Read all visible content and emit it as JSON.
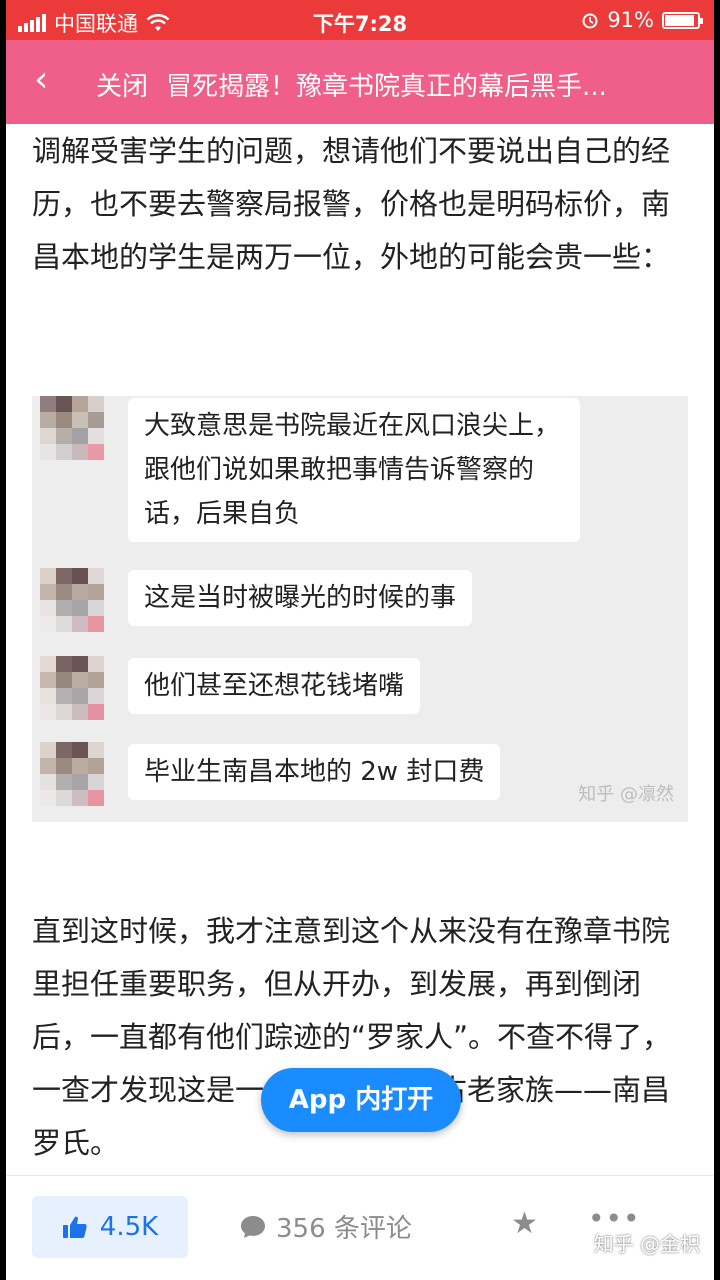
{
  "status_bar": {
    "carrier": "中国联通",
    "time": "下午7:28",
    "battery": "91%",
    "battery_level": 0.91
  },
  "nav": {
    "close_label": "关闭",
    "title": "冒死揭露！豫章书院真正的幕后黑手..."
  },
  "article": {
    "paragraph1": "调解受害学生的问题，想请他们不要说出自己的经历，也不要去警察局报警，价格也是明码标价，南昌本地的学生是两万一位，外地的可能会贵一些：",
    "chat_messages": [
      {
        "text": "大致意思是书院最近在风口浪尖上，跟他们说如果敢把事情告诉警察的话，后果自负"
      },
      {
        "text": "这是当时被曝光的时候的事"
      },
      {
        "text": "他们甚至还想花钱堵嘴"
      },
      {
        "text": "毕业生南昌本地的 2w 封口费"
      }
    ],
    "watermark": "知乎 @凛然",
    "paragraph2": "直到这时候，我才注意到这个从来没有在豫章书院里担任重要职务，但从开办，到发展，再到倒闭后，一直都有他们踪迹的“罗家人”。不查不得了，一查才发现这是一个延续千年的古老家族——南昌罗氏。"
  },
  "app_open_button": "App 内打开",
  "bottom_bar": {
    "likes": "4.5K",
    "comments": "356 条评论",
    "brand": "知乎 @金枳"
  },
  "colors": {
    "status_bar": "#ec3a3a",
    "nav_bar": "#ef5f8a",
    "accent_blue": "#1a8cff"
  }
}
